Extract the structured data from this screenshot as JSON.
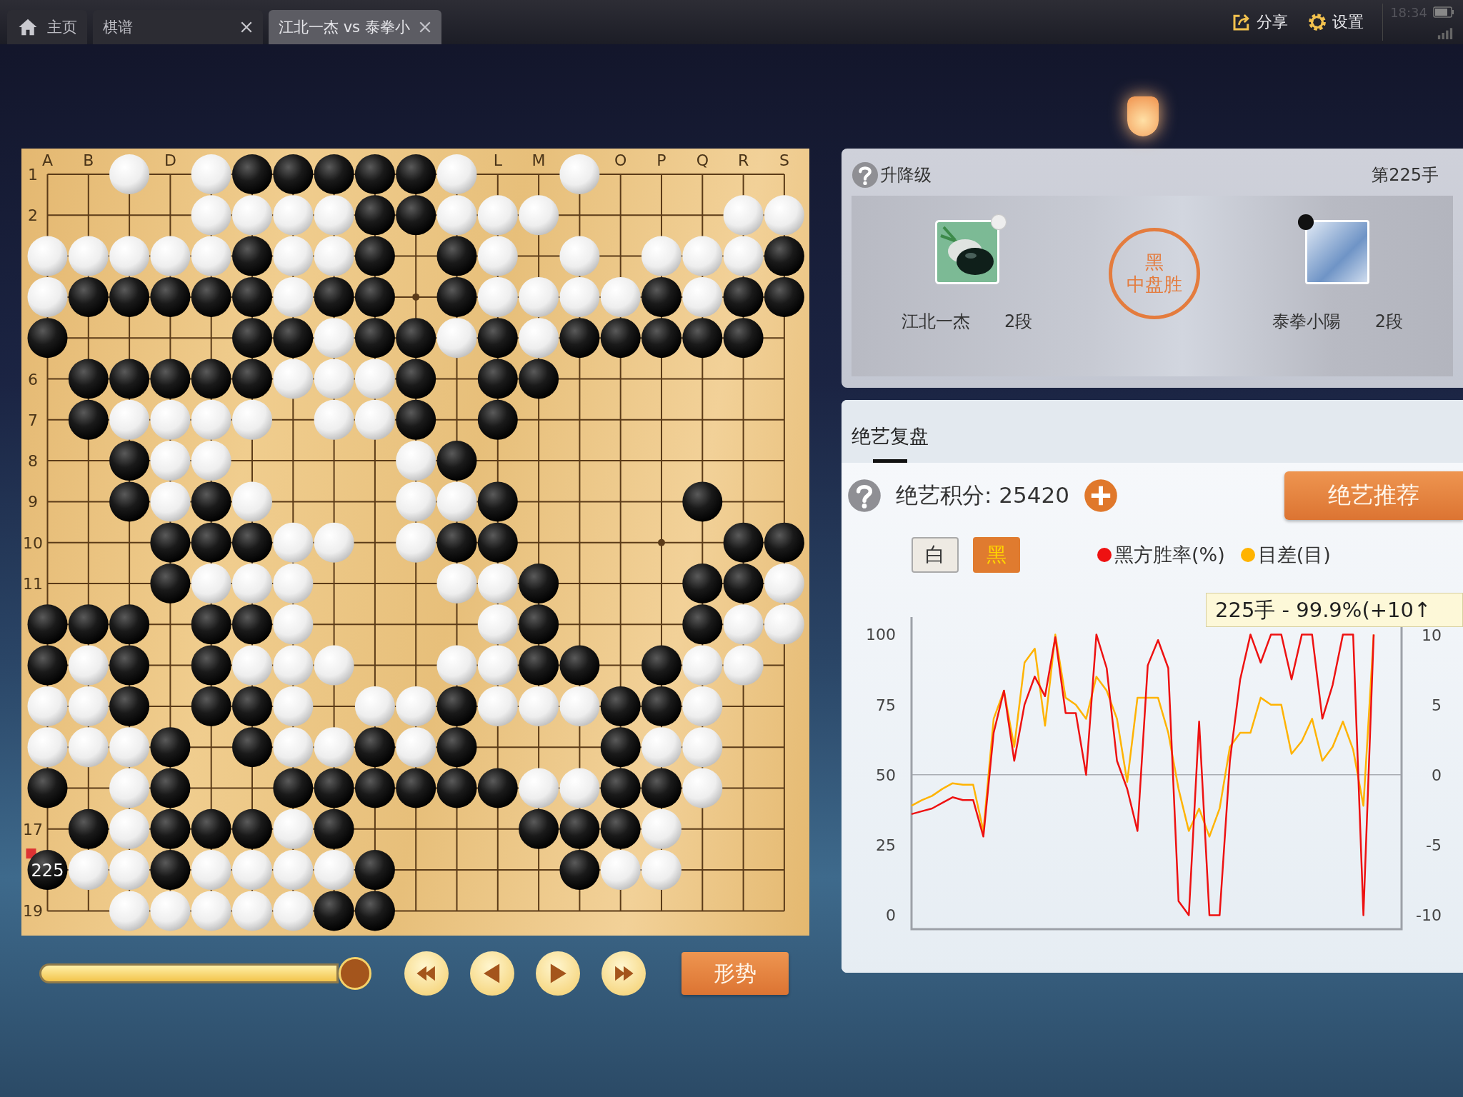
{
  "tabs": [
    {
      "label": "主页",
      "kind": "home",
      "selected": false,
      "closable": false
    },
    {
      "label": "棋谱",
      "kind": "plain",
      "selected": false,
      "closable": true
    },
    {
      "label": "江北一杰 vs 泰拳小",
      "kind": "plain",
      "selected": true,
      "closable": true
    }
  ],
  "toolbar": [
    {
      "label": "分享",
      "kind": "share"
    },
    {
      "label": "设置",
      "kind": "settings"
    }
  ],
  "status": {
    "time": "18:34"
  },
  "board": {
    "column_labels": [
      "A",
      "B",
      "D",
      "L",
      "M",
      "O",
      "P",
      "Q",
      "R",
      "S"
    ],
    "row_labels": [
      "1",
      "2",
      "6",
      "7",
      "8",
      "9",
      "10",
      "11",
      "17",
      "19"
    ],
    "rows": [
      [
        {
          "kind": "empty"
        },
        {
          "kind": "empty"
        },
        {
          "kind": "white"
        },
        {
          "kind": "empty"
        },
        {
          "kind": "white"
        },
        {
          "kind": "black"
        },
        {
          "kind": "black"
        },
        {
          "kind": "black"
        },
        {
          "kind": "black"
        },
        {
          "kind": "black"
        },
        {
          "kind": "white"
        },
        {
          "kind": "empty"
        },
        {
          "kind": "empty"
        },
        {
          "kind": "white"
        },
        {
          "kind": "empty"
        },
        {
          "kind": "empty"
        },
        {
          "kind": "empty"
        },
        {
          "kind": "empty"
        },
        {
          "kind": "empty"
        }
      ],
      [
        {
          "kind": "empty"
        },
        {
          "kind": "empty"
        },
        {
          "kind": "empty"
        },
        {
          "kind": "empty"
        },
        {
          "kind": "white"
        },
        {
          "kind": "white"
        },
        {
          "kind": "white"
        },
        {
          "kind": "white"
        },
        {
          "kind": "black"
        },
        {
          "kind": "black"
        },
        {
          "kind": "white"
        },
        {
          "kind": "white"
        },
        {
          "kind": "white"
        },
        {
          "kind": "empty"
        },
        {
          "kind": "empty"
        },
        {
          "kind": "empty"
        },
        {
          "kind": "empty"
        },
        {
          "kind": "white"
        },
        {
          "kind": "white"
        }
      ],
      [
        {
          "kind": "white"
        },
        {
          "kind": "white"
        },
        {
          "kind": "white"
        },
        {
          "kind": "white"
        },
        {
          "kind": "white"
        },
        {
          "kind": "black"
        },
        {
          "kind": "white"
        },
        {
          "kind": "white"
        },
        {
          "kind": "black"
        },
        {
          "kind": "empty"
        },
        {
          "kind": "black"
        },
        {
          "kind": "white"
        },
        {
          "kind": "empty"
        },
        {
          "kind": "white"
        },
        {
          "kind": "empty"
        },
        {
          "kind": "white"
        },
        {
          "kind": "white"
        },
        {
          "kind": "white"
        },
        {
          "kind": "black"
        }
      ],
      [
        {
          "kind": "white"
        },
        {
          "kind": "black"
        },
        {
          "kind": "black"
        },
        {
          "kind": "black"
        },
        {
          "kind": "black"
        },
        {
          "kind": "black"
        },
        {
          "kind": "white"
        },
        {
          "kind": "black"
        },
        {
          "kind": "black"
        },
        {
          "kind": "empty"
        },
        {
          "kind": "black"
        },
        {
          "kind": "white"
        },
        {
          "kind": "white"
        },
        {
          "kind": "white"
        },
        {
          "kind": "white"
        },
        {
          "kind": "black"
        },
        {
          "kind": "white"
        },
        {
          "kind": "black"
        },
        {
          "kind": "black"
        }
      ],
      [
        {
          "kind": "black"
        },
        {
          "kind": "empty"
        },
        {
          "kind": "empty"
        },
        {
          "kind": "empty"
        },
        {
          "kind": "empty"
        },
        {
          "kind": "black"
        },
        {
          "kind": "black"
        },
        {
          "kind": "white"
        },
        {
          "kind": "black"
        },
        {
          "kind": "black"
        },
        {
          "kind": "white"
        },
        {
          "kind": "black"
        },
        {
          "kind": "white"
        },
        {
          "kind": "black"
        },
        {
          "kind": "black"
        },
        {
          "kind": "black"
        },
        {
          "kind": "black"
        },
        {
          "kind": "black"
        },
        {
          "kind": "empty"
        }
      ],
      [
        {
          "kind": "empty"
        },
        {
          "kind": "black"
        },
        {
          "kind": "black"
        },
        {
          "kind": "black"
        },
        {
          "kind": "black"
        },
        {
          "kind": "black"
        },
        {
          "kind": "white"
        },
        {
          "kind": "white"
        },
        {
          "kind": "white"
        },
        {
          "kind": "black"
        },
        {
          "kind": "empty"
        },
        {
          "kind": "black"
        },
        {
          "kind": "black"
        },
        {
          "kind": "empty"
        },
        {
          "kind": "empty"
        },
        {
          "kind": "empty"
        },
        {
          "kind": "empty"
        },
        {
          "kind": "empty"
        },
        {
          "kind": "empty"
        }
      ],
      [
        {
          "kind": "empty"
        },
        {
          "kind": "black"
        },
        {
          "kind": "white"
        },
        {
          "kind": "white"
        },
        {
          "kind": "white"
        },
        {
          "kind": "white"
        },
        {
          "kind": "empty"
        },
        {
          "kind": "white"
        },
        {
          "kind": "white"
        },
        {
          "kind": "black"
        },
        {
          "kind": "empty"
        },
        {
          "kind": "black"
        },
        {
          "kind": "empty"
        },
        {
          "kind": "empty"
        },
        {
          "kind": "empty"
        },
        {
          "kind": "empty"
        },
        {
          "kind": "empty"
        },
        {
          "kind": "empty"
        },
        {
          "kind": "empty"
        }
      ],
      [
        {
          "kind": "empty"
        },
        {
          "kind": "empty"
        },
        {
          "kind": "black"
        },
        {
          "kind": "white"
        },
        {
          "kind": "white"
        },
        {
          "kind": "empty"
        },
        {
          "kind": "empty"
        },
        {
          "kind": "empty"
        },
        {
          "kind": "empty"
        },
        {
          "kind": "white"
        },
        {
          "kind": "black"
        },
        {
          "kind": "empty"
        },
        {
          "kind": "empty"
        },
        {
          "kind": "empty"
        },
        {
          "kind": "empty"
        },
        {
          "kind": "empty"
        },
        {
          "kind": "empty"
        },
        {
          "kind": "empty"
        },
        {
          "kind": "empty"
        }
      ],
      [
        {
          "kind": "empty"
        },
        {
          "kind": "empty"
        },
        {
          "kind": "black"
        },
        {
          "kind": "white"
        },
        {
          "kind": "black"
        },
        {
          "kind": "white"
        },
        {
          "kind": "empty"
        },
        {
          "kind": "empty"
        },
        {
          "kind": "empty"
        },
        {
          "kind": "white"
        },
        {
          "kind": "white"
        },
        {
          "kind": "black"
        },
        {
          "kind": "empty"
        },
        {
          "kind": "empty"
        },
        {
          "kind": "empty"
        },
        {
          "kind": "empty"
        },
        {
          "kind": "black"
        },
        {
          "kind": "empty"
        },
        {
          "kind": "empty"
        }
      ],
      [
        {
          "kind": "empty"
        },
        {
          "kind": "empty"
        },
        {
          "kind": "empty"
        },
        {
          "kind": "black"
        },
        {
          "kind": "black"
        },
        {
          "kind": "black"
        },
        {
          "kind": "white"
        },
        {
          "kind": "white"
        },
        {
          "kind": "empty"
        },
        {
          "kind": "white"
        },
        {
          "kind": "black"
        },
        {
          "kind": "black"
        },
        {
          "kind": "empty"
        },
        {
          "kind": "empty"
        },
        {
          "kind": "empty"
        },
        {
          "kind": "empty"
        },
        {
          "kind": "empty"
        },
        {
          "kind": "black"
        },
        {
          "kind": "black"
        }
      ],
      [
        {
          "kind": "empty"
        },
        {
          "kind": "empty"
        },
        {
          "kind": "empty"
        },
        {
          "kind": "black"
        },
        {
          "kind": "white"
        },
        {
          "kind": "white"
        },
        {
          "kind": "white"
        },
        {
          "kind": "empty"
        },
        {
          "kind": "empty"
        },
        {
          "kind": "empty"
        },
        {
          "kind": "white"
        },
        {
          "kind": "white"
        },
        {
          "kind": "black"
        },
        {
          "kind": "empty"
        },
        {
          "kind": "empty"
        },
        {
          "kind": "empty"
        },
        {
          "kind": "black"
        },
        {
          "kind": "black"
        },
        {
          "kind": "white"
        }
      ],
      [
        {
          "kind": "black"
        },
        {
          "kind": "black"
        },
        {
          "kind": "black"
        },
        {
          "kind": "empty"
        },
        {
          "kind": "black"
        },
        {
          "kind": "black"
        },
        {
          "kind": "white"
        },
        {
          "kind": "empty"
        },
        {
          "kind": "empty"
        },
        {
          "kind": "empty"
        },
        {
          "kind": "empty"
        },
        {
          "kind": "white"
        },
        {
          "kind": "black"
        },
        {
          "kind": "empty"
        },
        {
          "kind": "empty"
        },
        {
          "kind": "empty"
        },
        {
          "kind": "black"
        },
        {
          "kind": "white"
        },
        {
          "kind": "white"
        }
      ],
      [
        {
          "kind": "black"
        },
        {
          "kind": "white"
        },
        {
          "kind": "black"
        },
        {
          "kind": "empty"
        },
        {
          "kind": "black"
        },
        {
          "kind": "white"
        },
        {
          "kind": "white"
        },
        {
          "kind": "white"
        },
        {
          "kind": "empty"
        },
        {
          "kind": "empty"
        },
        {
          "kind": "white"
        },
        {
          "kind": "white"
        },
        {
          "kind": "black"
        },
        {
          "kind": "black"
        },
        {
          "kind": "empty"
        },
        {
          "kind": "black"
        },
        {
          "kind": "white"
        },
        {
          "kind": "white"
        },
        {
          "kind": "empty"
        }
      ],
      [
        {
          "kind": "white"
        },
        {
          "kind": "white"
        },
        {
          "kind": "black"
        },
        {
          "kind": "empty"
        },
        {
          "kind": "black"
        },
        {
          "kind": "black"
        },
        {
          "kind": "white"
        },
        {
          "kind": "empty"
        },
        {
          "kind": "white"
        },
        {
          "kind": "white"
        },
        {
          "kind": "black"
        },
        {
          "kind": "white"
        },
        {
          "kind": "white"
        },
        {
          "kind": "white"
        },
        {
          "kind": "black"
        },
        {
          "kind": "black"
        },
        {
          "kind": "white"
        },
        {
          "kind": "empty"
        },
        {
          "kind": "empty"
        }
      ],
      [
        {
          "kind": "white"
        },
        {
          "kind": "white"
        },
        {
          "kind": "white"
        },
        {
          "kind": "black"
        },
        {
          "kind": "empty"
        },
        {
          "kind": "black"
        },
        {
          "kind": "white"
        },
        {
          "kind": "white"
        },
        {
          "kind": "black"
        },
        {
          "kind": "white"
        },
        {
          "kind": "black"
        },
        {
          "kind": "empty"
        },
        {
          "kind": "empty"
        },
        {
          "kind": "empty"
        },
        {
          "kind": "black"
        },
        {
          "kind": "white"
        },
        {
          "kind": "white"
        },
        {
          "kind": "empty"
        },
        {
          "kind": "empty"
        }
      ],
      [
        {
          "kind": "black"
        },
        {
          "kind": "empty"
        },
        {
          "kind": "white"
        },
        {
          "kind": "black"
        },
        {
          "kind": "empty"
        },
        {
          "kind": "empty"
        },
        {
          "kind": "black"
        },
        {
          "kind": "black"
        },
        {
          "kind": "black"
        },
        {
          "kind": "black"
        },
        {
          "kind": "black"
        },
        {
          "kind": "black"
        },
        {
          "kind": "white"
        },
        {
          "kind": "white"
        },
        {
          "kind": "black"
        },
        {
          "kind": "black"
        },
        {
          "kind": "white"
        },
        {
          "kind": "empty"
        },
        {
          "kind": "empty"
        }
      ],
      [
        {
          "kind": "empty"
        },
        {
          "kind": "black"
        },
        {
          "kind": "white"
        },
        {
          "kind": "black"
        },
        {
          "kind": "black"
        },
        {
          "kind": "black"
        },
        {
          "kind": "white"
        },
        {
          "kind": "black"
        },
        {
          "kind": "empty"
        },
        {
          "kind": "empty"
        },
        {
          "kind": "empty"
        },
        {
          "kind": "empty"
        },
        {
          "kind": "black"
        },
        {
          "kind": "black"
        },
        {
          "kind": "black"
        },
        {
          "kind": "white"
        },
        {
          "kind": "empty"
        },
        {
          "kind": "empty"
        },
        {
          "kind": "empty"
        }
      ],
      [
        {
          "kind": "black",
          "last_move": true,
          "number": "225"
        },
        {
          "kind": "white"
        },
        {
          "kind": "white"
        },
        {
          "kind": "black"
        },
        {
          "kind": "white"
        },
        {
          "kind": "white"
        },
        {
          "kind": "white"
        },
        {
          "kind": "white"
        },
        {
          "kind": "black"
        },
        {
          "kind": "empty"
        },
        {
          "kind": "empty"
        },
        {
          "kind": "empty"
        },
        {
          "kind": "empty"
        },
        {
          "kind": "black"
        },
        {
          "kind": "white"
        },
        {
          "kind": "white"
        },
        {
          "kind": "empty"
        },
        {
          "kind": "empty"
        },
        {
          "kind": "empty"
        }
      ],
      [
        {
          "kind": "empty"
        },
        {
          "kind": "empty"
        },
        {
          "kind": "white"
        },
        {
          "kind": "white"
        },
        {
          "kind": "white"
        },
        {
          "kind": "white"
        },
        {
          "kind": "white"
        },
        {
          "kind": "black"
        },
        {
          "kind": "black"
        },
        {
          "kind": "empty"
        },
        {
          "kind": "empty"
        },
        {
          "kind": "empty"
        },
        {
          "kind": "empty"
        },
        {
          "kind": "empty"
        },
        {
          "kind": "empty"
        },
        {
          "kind": "empty"
        },
        {
          "kind": "empty"
        },
        {
          "kind": "empty"
        },
        {
          "kind": "empty"
        }
      ]
    ]
  },
  "playback": {
    "level": 1.0,
    "buttons": [
      {
        "kind": "rewind"
      },
      {
        "kind": "previous"
      },
      {
        "kind": "play"
      },
      {
        "kind": "fast-forward"
      }
    ],
    "form_button": "形势"
  },
  "game_panel": {
    "title": "升降级",
    "move": "第225手",
    "players": [
      {
        "name": "江北一杰",
        "rank": "2段",
        "color": "#eeeeee",
        "kind": "stones"
      },
      {
        "name": "泰拳小陽",
        "rank": "2段",
        "color": "#111111",
        "kind": "illustration"
      }
    ],
    "result": {
      "winner": "黑",
      "text": "中盘胜"
    }
  },
  "analysis_panel": {
    "tabs": [
      {
        "label": "绝艺复盘",
        "selected": true
      }
    ],
    "points_label": "绝艺积分: 25420",
    "recommend_button": "绝艺推荐",
    "sides": [
      {
        "label": "白",
        "selected": false
      },
      {
        "label": "黑",
        "selected": true
      }
    ],
    "tooltip": "225手 - 99.9%(+10↑",
    "chart_data": {
      "type": "line",
      "ylim": [
        -5,
        106.2
      ],
      "yticks": [
        0,
        25,
        50,
        75,
        100
      ],
      "y2lim": [
        -11,
        11.25
      ],
      "y2ticks": [
        -10,
        -5,
        0,
        5,
        10
      ],
      "categories": [
        null,
        null,
        null,
        null,
        null,
        null,
        null,
        null,
        null,
        null,
        null,
        null,
        null,
        null,
        null,
        null,
        null,
        null,
        null,
        null,
        null,
        null,
        null,
        null,
        null,
        null,
        null,
        null,
        null,
        null,
        null,
        null,
        null,
        null,
        null,
        null,
        null,
        null,
        null,
        null,
        null,
        null,
        null,
        null,
        null,
        null
      ],
      "series": [
        {
          "name": "黑方胜率(%)",
          "color": "#ee1111",
          "values": [
            36,
            37,
            38,
            40,
            42,
            41,
            41,
            28,
            65,
            80,
            55,
            75,
            85,
            78,
            99,
            72,
            72,
            50,
            100,
            88,
            55,
            45,
            30,
            89,
            98,
            88,
            5,
            0,
            69,
            0,
            0,
            55,
            84,
            100,
            90,
            100,
            100,
            84,
            100,
            100,
            70,
            82,
            100,
            100,
            0,
            100
          ]
        },
        {
          "name": "目差(目)",
          "color": "#ffb300",
          "axis": "y2",
          "values": [
            -2.2,
            -1.8,
            -1.5,
            -1,
            -0.6,
            -0.7,
            -0.7,
            -4,
            4,
            6,
            2,
            8,
            9,
            3.5,
            10,
            5.5,
            5,
            4,
            7,
            6,
            4,
            -0.5,
            5.5,
            5.5,
            5.5,
            3,
            -1,
            -4,
            -2.4,
            -4.4,
            -2.4,
            2,
            3,
            3,
            5.5,
            5,
            5,
            1.5,
            2.4,
            4,
            1,
            2,
            3.8,
            1.8,
            -2.2,
            10
          ]
        }
      ]
    }
  }
}
